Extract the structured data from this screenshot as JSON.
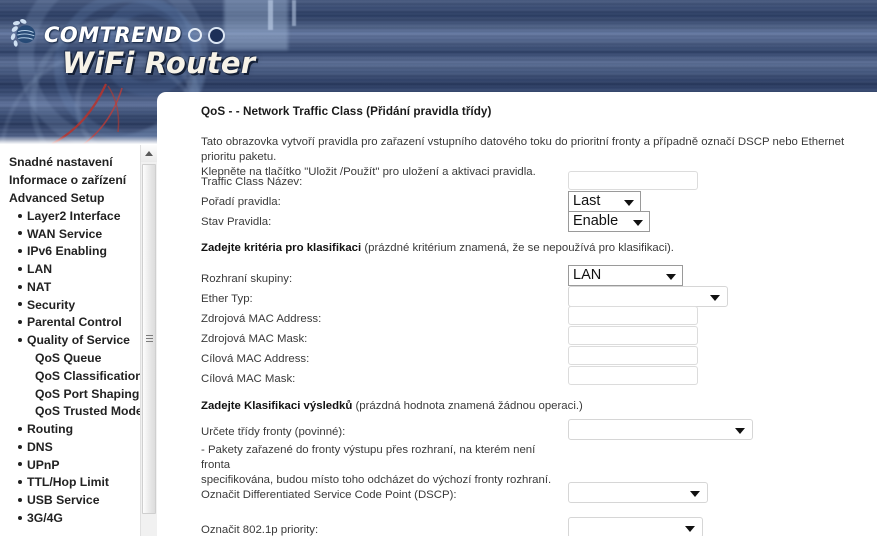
{
  "banner": {
    "brand": "COMTREND",
    "product": "WiFi Router",
    "logo_icon": "comtrend-flower-logo-icon"
  },
  "sidebar": {
    "items": [
      {
        "label": "Snadné nastavení",
        "level": 0,
        "bullet": false
      },
      {
        "label": "Informace o zařízení",
        "level": 0,
        "bullet": false
      },
      {
        "label": "Advanced Setup",
        "level": 0,
        "bullet": false
      },
      {
        "label": "Layer2 Interface",
        "level": 1,
        "bullet": true
      },
      {
        "label": "WAN Service",
        "level": 1,
        "bullet": true
      },
      {
        "label": "IPv6 Enabling",
        "level": 1,
        "bullet": true
      },
      {
        "label": "LAN",
        "level": 1,
        "bullet": true
      },
      {
        "label": "NAT",
        "level": 1,
        "bullet": true
      },
      {
        "label": "Security",
        "level": 1,
        "bullet": true
      },
      {
        "label": "Parental Control",
        "level": 1,
        "bullet": true
      },
      {
        "label": "Quality of Service",
        "level": 1,
        "bullet": true
      },
      {
        "label": "QoS Queue",
        "level": 2,
        "bullet": false
      },
      {
        "label": "QoS Classification",
        "level": 2,
        "bullet": false
      },
      {
        "label": "QoS Port Shaping",
        "level": 2,
        "bullet": false
      },
      {
        "label": "QoS Trusted Mode",
        "level": 2,
        "bullet": false
      },
      {
        "label": "Routing",
        "level": 1,
        "bullet": true
      },
      {
        "label": "DNS",
        "level": 1,
        "bullet": true
      },
      {
        "label": "UPnP",
        "level": 1,
        "bullet": true
      },
      {
        "label": "TTL/Hop Limit",
        "level": 1,
        "bullet": true
      },
      {
        "label": "USB Service",
        "level": 1,
        "bullet": true
      },
      {
        "label": "3G/4G",
        "level": 1,
        "bullet": true
      }
    ],
    "scrollbar": {
      "up_arrow_icon": "scroll-up-arrow-icon",
      "thumb_grip_icon": "scrollbar-grip-icon"
    }
  },
  "main": {
    "page_title": "QoS - - Network Traffic Class (Přidání pravidla třídy)",
    "intro_line1": "Tato obrazovka vytvoří pravidla pro zařazení vstupního datového toku do prioritní fronty a případně označí DSCP nebo Ethernet prioritu paketu.",
    "intro_line2": "Klepněte na tlačítko \"Uložit /Použít\" pro uložení a aktivaci pravidla.",
    "fields": {
      "traffic_class_name": {
        "label": "Traffic Class Název:",
        "value": ""
      },
      "rule_order": {
        "label": "Pořadí pravidla:",
        "value": "Last"
      },
      "rule_status": {
        "label": "Stav Pravidla:",
        "value": "Enable"
      },
      "interface_group": {
        "label": "Rozhraní skupiny:",
        "value": "LAN"
      },
      "ether_type": {
        "label": "Ether Typ:",
        "value": ""
      },
      "source_mac_address": {
        "label": "Zdrojová MAC Address:",
        "value": ""
      },
      "source_mac_mask": {
        "label": "Zdrojová MAC Mask:",
        "value": ""
      },
      "dest_mac_address": {
        "label": "Cílová MAC Address:",
        "value": ""
      },
      "dest_mac_mask": {
        "label": "Cílová MAC Mask:",
        "value": ""
      },
      "queue_class": {
        "label": "Určete třídy fronty (povinné):",
        "value": ""
      },
      "dscp_mark": {
        "label": "Označit Differentiated Service Code Point (DSCP):",
        "value": ""
      },
      "priority_8021p": {
        "label": "Označit 802.1p priority:",
        "value": ""
      }
    },
    "sections": {
      "criteria_bold": "Zadejte kritéria pro klasifikaci",
      "criteria_rest": " (prázdné kritérium znamená, že se nepoužívá pro klasifikaci).",
      "results_bold": "Zadejte Klasifikaci výsledků",
      "results_rest": " (prázdná hodnota znamená žádnou operaci.)"
    },
    "queue_note_line1": "- Pakety zařazené do fronty výstupu přes rozhraní, na kterém není fronta",
    "queue_note_line2": "specifikována, budou místo toho odcházet do výchozí fronty rozhraní."
  },
  "colors": {
    "banner_dark": "#2b3d63",
    "banner_light": "#6377a0",
    "panel_bg": "#ffffff",
    "text": "#3a3a3a",
    "accent_red": "#c0392b"
  }
}
